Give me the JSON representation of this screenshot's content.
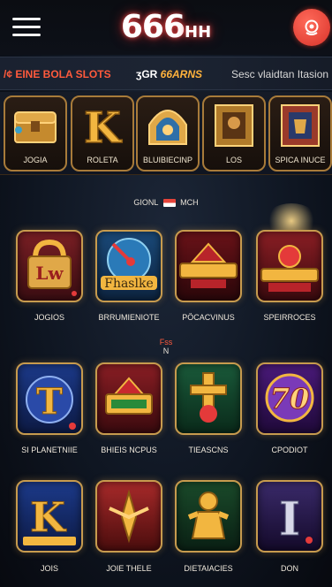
{
  "header": {
    "logo_main": "666",
    "logo_small": "HH"
  },
  "ticker": {
    "item1": "/¢ EINE BOLA SLOTS",
    "item2_prefix": "ʒGR",
    "item2_highlight": "66ARNS",
    "item3": "Sesc vlaidtan Itasion"
  },
  "categories": [
    {
      "label": "JOGIA"
    },
    {
      "label": "ROLETA"
    },
    {
      "label": "BLUIBIECINP"
    },
    {
      "label": "LOS"
    },
    {
      "label": "SPICA INUCE"
    }
  ],
  "sections": {
    "first": {
      "left": "GIONL",
      "right": "MCH"
    },
    "second": {
      "top": "Fss",
      "bottom": "N"
    }
  },
  "games": [
    {
      "label": "JOGIOS",
      "art": "Lw"
    },
    {
      "label": "BRRUMIENIOTE",
      "art": "Fhaslke"
    },
    {
      "label": "PÖCACVINUS",
      "art": ""
    },
    {
      "label": "SPEIRROCES",
      "art": ""
    },
    {
      "label": "SI PLANETNIIE",
      "art": "T"
    },
    {
      "label": "BHIEIS NCPUS",
      "art": ""
    },
    {
      "label": "TIEASCNS",
      "art": ""
    },
    {
      "label": "CPODIOT",
      "art": "70"
    },
    {
      "label": "JOIS",
      "art": "K"
    },
    {
      "label": "JOIE THELE",
      "art": ""
    },
    {
      "label": "DIETAIACIES",
      "art": ""
    },
    {
      "label": "DON",
      "art": "I"
    }
  ],
  "colors": {
    "accent_red": "#e4433a",
    "gold": "#c79b4e",
    "ticker_orange": "#ff5a3c",
    "ticker_gold": "#ffb23c"
  }
}
